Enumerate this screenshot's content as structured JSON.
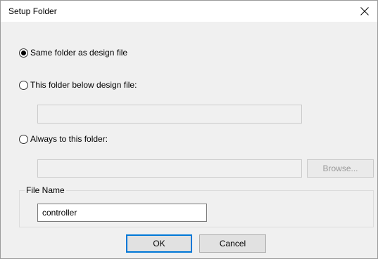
{
  "window": {
    "title": "Setup Folder"
  },
  "options": [
    {
      "label": "Same folder as design file",
      "checked": true
    },
    {
      "label": "This folder below design file:",
      "checked": false
    },
    {
      "label": "Always to this folder:",
      "checked": false
    }
  ],
  "fields": {
    "below_folder_value": "",
    "always_folder_value": "",
    "file_name_value": "controller"
  },
  "buttons": {
    "browse_label": "Browse...",
    "ok_label": "OK",
    "cancel_label": "Cancel"
  },
  "group": {
    "file_name_label": "File Name"
  }
}
